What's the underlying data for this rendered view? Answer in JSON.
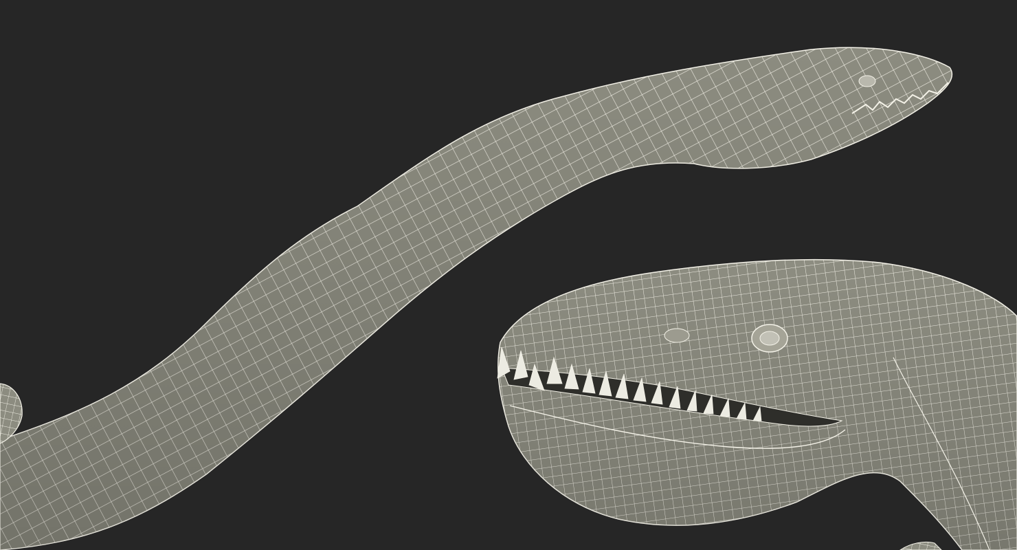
{
  "scene": {
    "background_color": "#262626",
    "mesh_fill_color": "#8c8c80",
    "wire_color": "#f4f2e8",
    "shadow_color": "#6f6f64",
    "teeth_color": "#ecebe2",
    "subjects": [
      "serpent-neck-wireframe",
      "serpent-head-wireframe-closeup"
    ]
  }
}
